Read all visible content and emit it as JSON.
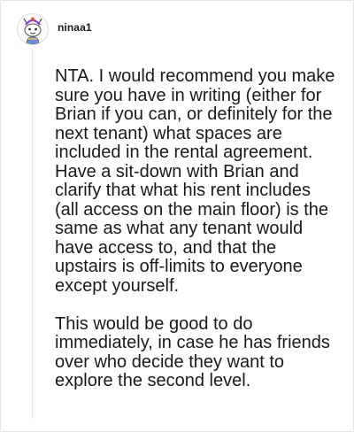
{
  "comment": {
    "author": {
      "username": "ninaa1",
      "avatar_icon": "snoo-avatar-icon"
    },
    "paragraphs": [
      "NTA. I would recommend you make sure you have in writing (either for Brian if you can, or definitely for the next tenant) what spaces are included in the rental agreement. Have a sit-down with Brian and clarify that what his rent includes (all access on the main floor) is the same as what any tenant would have access to, and that the upstairs is off-limits to everyone except yourself.",
      "This would be good to do immediately, in case he has friends over who decide they want to explore the second level."
    ]
  },
  "colors": {
    "background": "#ffffff",
    "text": "#1a1a1b",
    "thread_line": "#e6e6e6",
    "avatar_accent": "#8a3cc7"
  }
}
